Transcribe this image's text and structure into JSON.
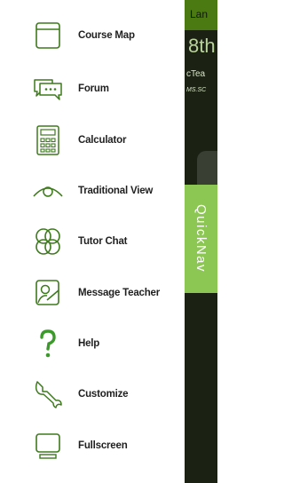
{
  "menu": {
    "items": [
      {
        "label": "Course Map",
        "icon": "course-map-icon"
      },
      {
        "label": "Forum",
        "icon": "forum-icon"
      },
      {
        "label": "Calculator",
        "icon": "calculator-icon"
      },
      {
        "label": "Traditional View",
        "icon": "eye-icon"
      },
      {
        "label": "Tutor Chat",
        "icon": "tutor-chat-icon"
      },
      {
        "label": "Message Teacher",
        "icon": "message-teacher-icon"
      },
      {
        "label": "Help",
        "icon": "help-icon"
      },
      {
        "label": "Customize",
        "icon": "wrench-icon"
      },
      {
        "label": "Fullscreen",
        "icon": "fullscreen-icon"
      }
    ]
  },
  "background": {
    "header": "Lan",
    "course": "8th",
    "teacher": "cTea",
    "class_label": "MS.SC"
  },
  "quicknav": {
    "label": "QuickNav"
  },
  "colors": {
    "accent": "#8cc753",
    "icon_green": "#3d7a1c",
    "help_green": "#3b9a2a",
    "panel_dark": "#1b2113"
  }
}
